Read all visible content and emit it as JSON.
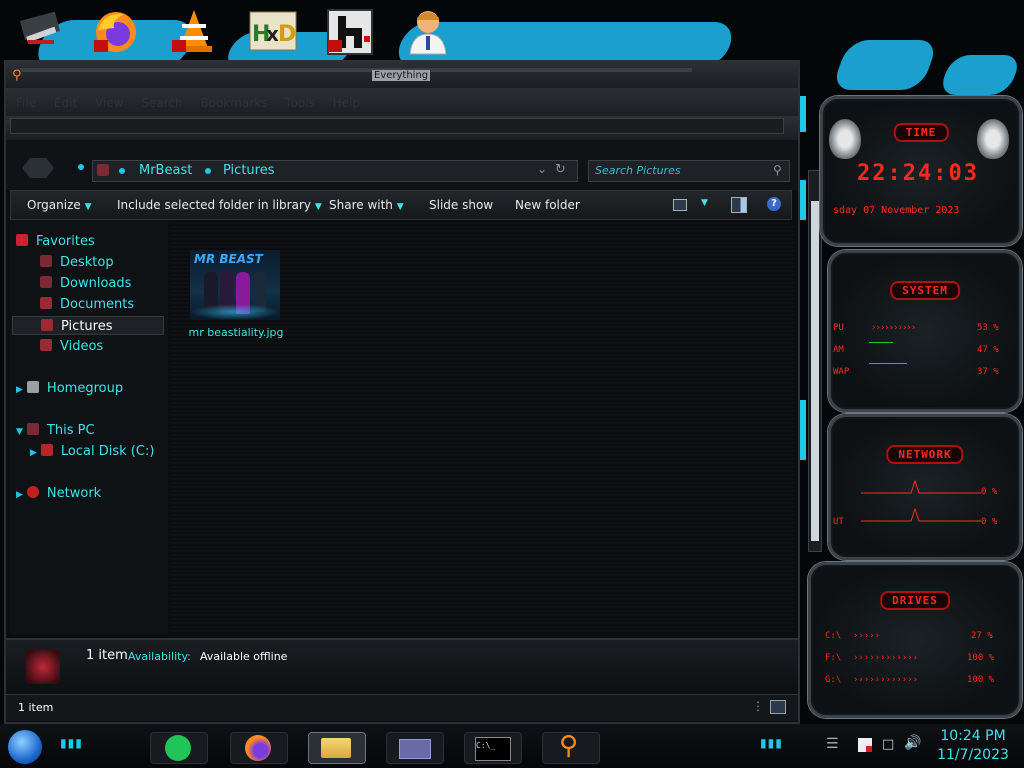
{
  "desktop": {
    "icons": [
      {
        "name": "tools-icon"
      },
      {
        "name": "firefox-icon"
      },
      {
        "name": "vlc-icon"
      },
      {
        "name": "hxd-icon"
      },
      {
        "name": "h-app-icon"
      },
      {
        "name": "doctor-icon"
      }
    ]
  },
  "everything_bar": {
    "title": "Everything"
  },
  "menu": {
    "file": "File",
    "edit": "Edit",
    "view": "View",
    "search": "Search",
    "bookmarks": "Bookmarks",
    "tools": "Tools",
    "help": "Help"
  },
  "address": {
    "crumb1": "MrBeast",
    "crumb2": "Pictures",
    "search_placeholder": "Search Pictures"
  },
  "toolbar": {
    "organize": "Organize",
    "include": "Include selected folder in library",
    "share": "Share with",
    "slideshow": "Slide show",
    "newfolder": "New folder"
  },
  "nav": {
    "favorites": "Favorites",
    "desktop": "Desktop",
    "downloads": "Downloads",
    "documents": "Documents",
    "pictures": "Pictures",
    "videos": "Videos",
    "homegroup": "Homegroup",
    "thispc": "This PC",
    "localdisk": "Local Disk (C:)",
    "network": "Network"
  },
  "file": {
    "name": "mr beastiality.jpg",
    "thumb_text": "MR BEAST"
  },
  "details": {
    "count": "1 item",
    "avail_label": "Availability:",
    "avail_value": "Available offline"
  },
  "statusbar": {
    "count": "1 item"
  },
  "gadgets": {
    "time": {
      "title": "TIME",
      "clock": "22:24:03",
      "date": "sday 07 November 2023"
    },
    "system": {
      "title": "SYSTEM",
      "rows": [
        {
          "label": "PU",
          "value": "53 %"
        },
        {
          "label": "AM",
          "value": "47 %"
        },
        {
          "label": "WAP",
          "value": "37 %"
        }
      ]
    },
    "network": {
      "title": "NETWORK",
      "rows": [
        {
          "label": "",
          "value": "0 %"
        },
        {
          "label": "UT",
          "value": "0 %"
        }
      ]
    },
    "drives": {
      "title": "DRIVES",
      "rows": [
        {
          "label": "C:\\",
          "value": "27 %"
        },
        {
          "label": "F:\\",
          "value": "100 %"
        },
        {
          "label": "G:\\",
          "value": "100 %"
        }
      ]
    }
  },
  "taskbar": {
    "cmd_label": "C:\\_",
    "time": "10:24 PM",
    "date": "11/7/2023"
  },
  "colors": {
    "accent_cyan": "#3fe3e6",
    "accent_red": "#ff2a1e",
    "wallpaper_blue": "#1a9fcf"
  }
}
